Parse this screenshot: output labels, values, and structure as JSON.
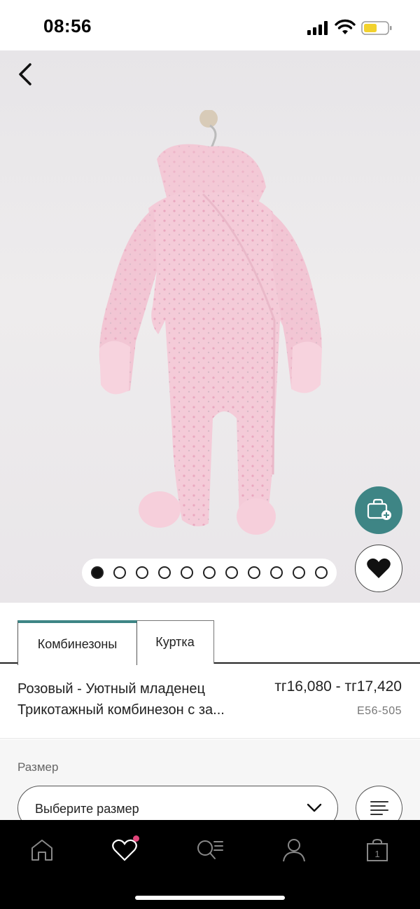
{
  "status_bar": {
    "time": "08:56"
  },
  "gallery": {
    "image_count": 11,
    "active_index": 0
  },
  "tabs": [
    {
      "label": "Комбинезоны",
      "active": true
    },
    {
      "label": "Куртка",
      "active": false
    }
  ],
  "product": {
    "name_line1": "Розовый - Уютный младенец",
    "name_line2": "Трикотажный комбинезон с за...",
    "price": "тг16,080 - тг17,420",
    "code": "E56-505"
  },
  "size": {
    "label": "Размер",
    "select_value": "Выберите размер"
  },
  "bottom_nav": {
    "bag_count": "1"
  },
  "colors": {
    "accent": "#3e8585",
    "badge": "#e0457a"
  }
}
